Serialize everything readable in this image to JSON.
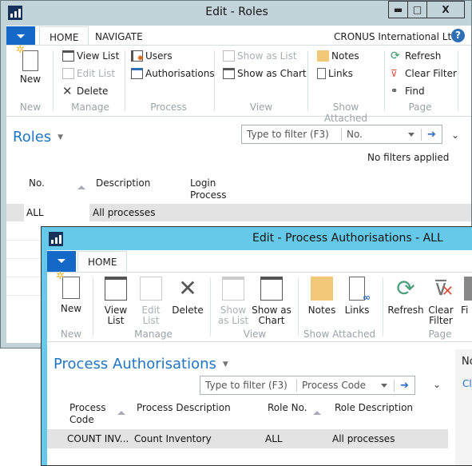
{
  "back_window": {
    "title": "Edit - Roles",
    "controls": {
      "minimize": "▬",
      "maximize": "□",
      "close": "X"
    },
    "tabs": [
      {
        "label": "HOME",
        "active": true
      },
      {
        "label": "NAVIGATE",
        "active": false
      }
    ],
    "company": "CRONUS International Ltd.",
    "help_icon": "?",
    "ribbon": {
      "new": {
        "label": "New",
        "group": "New"
      },
      "manage": {
        "group": "Manage",
        "items": [
          "View List",
          "Edit List",
          "Delete"
        ]
      },
      "process": {
        "group": "Process",
        "items": [
          "Users",
          "Authorisations"
        ]
      },
      "view": {
        "group": "View",
        "items": [
          "Show as List",
          "Show as Chart"
        ]
      },
      "attached": {
        "group": "Show Attached",
        "items": [
          "Notes",
          "Links"
        ]
      },
      "page": {
        "group": "Page",
        "items": [
          "Refresh",
          "Clear Filter",
          "Find"
        ]
      }
    },
    "page_title": "Roles",
    "filter": {
      "placeholder": "Type to filter (F3)",
      "field": "No."
    },
    "filter_status": "No filters applied",
    "columns": [
      "No.",
      "Description",
      "Login\nProcess"
    ],
    "rows": [
      {
        "no": "ALL",
        "description": "All processes",
        "login_process": ""
      }
    ]
  },
  "front_window": {
    "title": "Edit - Process Authorisations - ALL",
    "tabs": [
      {
        "label": "HOME",
        "active": true
      }
    ],
    "ribbon": {
      "new": {
        "label": "New",
        "group": "New"
      },
      "manage": {
        "group": "Manage",
        "items": [
          "View\nList",
          "Edit\nList",
          "Delete"
        ]
      },
      "view": {
        "group": "View",
        "items": [
          "Show\nas List",
          "Show as\nChart"
        ]
      },
      "attached": {
        "group": "Show Attached",
        "items": [
          "Notes",
          "Links"
        ]
      },
      "page": {
        "group": "Page",
        "items": [
          "Refresh",
          "Clear\nFilter",
          "Fi"
        ]
      }
    },
    "page_title": "Process Authorisations",
    "filter": {
      "placeholder": "Type to filter (F3)",
      "field": "Process Code"
    },
    "factbox": {
      "title": "No",
      "link": "Cl"
    },
    "columns": [
      "Process\nCode",
      "Process Description",
      "Role No.",
      "Role Description"
    ],
    "rows": [
      {
        "process_code": "COUNT INV...",
        "process_description": "Count Inventory",
        "role_no": "ALL",
        "role_description": "All processes"
      }
    ]
  },
  "colors": {
    "accent": "#1f74c4",
    "menu_button": "#1469c8",
    "back_frame": "#c3d3da",
    "front_frame": "#66c9e9",
    "selected_row": "#e3e3e3"
  }
}
